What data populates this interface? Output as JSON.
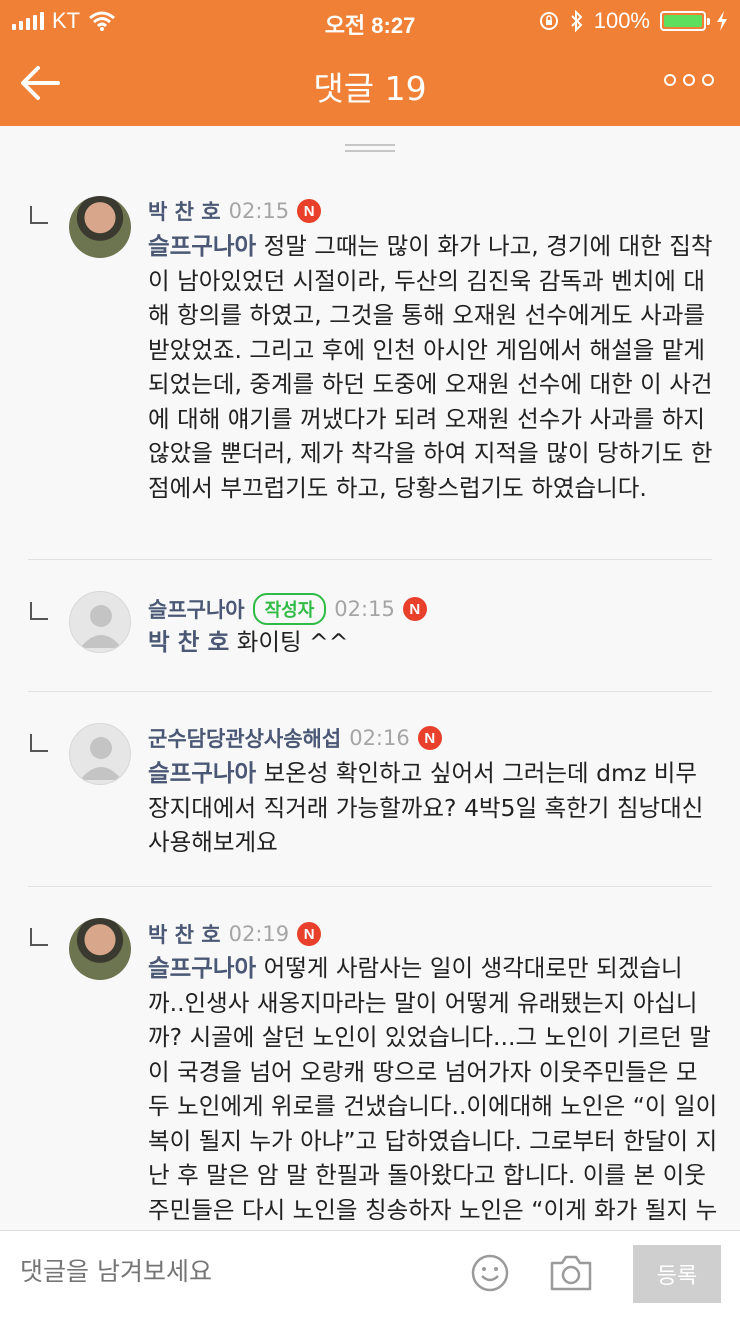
{
  "status_bar": {
    "carrier": "KT",
    "time": "오전 8:27",
    "battery": "100%",
    "battery_color": "#5ee05e"
  },
  "header": {
    "title": "댓글 19",
    "back_icon": "arrow-left-icon",
    "more_icon": "more-dots-icon",
    "color": "#f08035"
  },
  "comments": [
    {
      "author": "박 찬 호",
      "time": "02:15",
      "new_badge": "N",
      "mention": "슬프구나아",
      "text": " 정말 그때는 많이 화가 나고, 경기에 대한 집착이 남아있었던 시절이라, 두산의 김진욱 감독과 벤치에 대해 항의를 하였고, 그것을 통해 오재원 선수에게도 사과를 받았었죠. 그리고 후에 인천 아시안 게임에서 해설을 맡게 되었는데, 중계를 하던 도중에 오재원 선수에 대한 이 사건에 대해 얘기를 꺼냈다가 되려 오재원 선수가 사과를 하지 않았을 뿐더러, 제가 착각을 하여 지적을 많이 당하기도 한 점에서 부끄럽기도 하고, 당황스럽기도 하였습니다."
    },
    {
      "author": "슬프구나아",
      "author_badge": "작성자",
      "time": "02:15",
      "new_badge": "N",
      "mention": "박 찬 호",
      "text": " 화이팅 ^^"
    },
    {
      "author": "군수담당관상사송해섭",
      "time": "02:16",
      "new_badge": "N",
      "mention": "슬프구나아",
      "text": " 보온성 확인하고 싶어서 그러는데 dmz 비무장지대에서 직거래 가능할까요? 4박5일 혹한기 침낭대신 사용해보게요"
    },
    {
      "author": "박 찬 호",
      "time": "02:19",
      "new_badge": "N",
      "mention": "슬프구나아",
      "text": " 어떻게 사람사는 일이 생각대로만 되겠습니까..인생사 새옹지마라는 말이 어떻게 유래됐는지 아십니까? 시골에 살던 노인이 있었습니다...그 노인이 기르던 말이 국경을 넘어 오랑캐 땅으로 넘어가자 이웃주민들은 모두 노인에게 위로를 건냈습니다..이에대해 노인은 “이 일이 복이 될지 누가 아냐”고 답하였습니다. 그로부터 한달이 지난 후 말은 암 말 한필과 돌아왔다고 합니다. 이를 본 이웃주민들은 다시 노인을 칭송하자 노인은 “이게 화가 될지 누가 압니까”"
    }
  ],
  "input": {
    "placeholder": "댓글을 남겨보세요",
    "emoji_icon": "emoji-icon",
    "camera_icon": "camera-icon",
    "submit_label": "등록"
  }
}
